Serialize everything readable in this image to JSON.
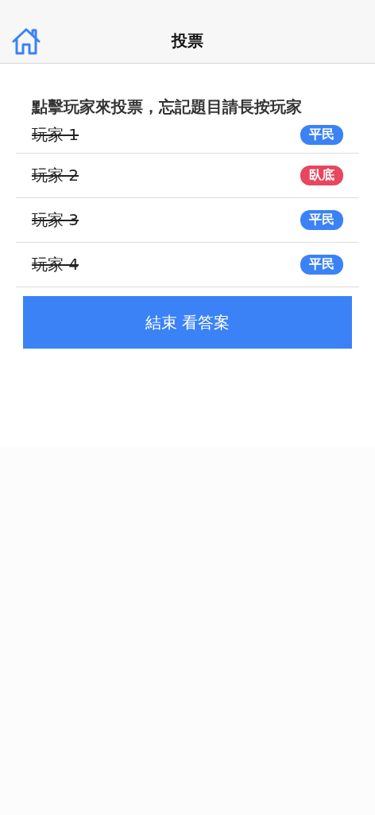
{
  "header": {
    "title": "投票"
  },
  "instruction": "點擊玩家來投票，忘記題目請長按玩家",
  "players": [
    {
      "name": "玩家 1",
      "struck": true,
      "role": "平民",
      "color": "#3b82f6"
    },
    {
      "name": "玩家 2",
      "struck": true,
      "role": "臥底",
      "color": "#e8465f"
    },
    {
      "name": "玩家 3",
      "struck": true,
      "role": "平民",
      "color": "#3b82f6"
    },
    {
      "name": "玩家 4",
      "struck": true,
      "role": "平民",
      "color": "#3b82f6"
    }
  ],
  "button": "結束 看答案"
}
